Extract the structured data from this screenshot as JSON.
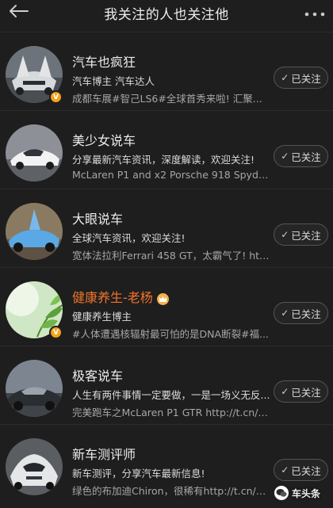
{
  "header": {
    "title": "我关注的人也关注他",
    "back_icon": "arrow-left-icon",
    "more_icon": "more-dots-icon"
  },
  "users": [
    {
      "name": "汽车也疯狂",
      "line1": "汽车博主 汽车达人",
      "line2": "成都车展#智己LS6#全球首秀来啦! 汇聚...",
      "follow_label": "已关注",
      "verified": true
    },
    {
      "name": "美少女说车",
      "line1": "分享最新汽车资讯，深度解读，欢迎关注!",
      "line2": "McLaren P1 and x2 Porsche 918 Spyders...",
      "follow_label": "已关注",
      "verified": false
    },
    {
      "name": "大眼说车",
      "line1": "全球汽车资讯，欢迎关注!",
      "line2": "宽体法拉利Ferrari 458 GT，太霸气了! htt...",
      "follow_label": "已关注",
      "verified": false
    },
    {
      "name": "健康养生-老杨",
      "line1": "健康养生博主",
      "line2": "#人体遭遇核辐射最可怕的是DNA断裂#福...",
      "follow_label": "已关注",
      "verified": true
    },
    {
      "name": "极客说车",
      "line1": "人生有两件事情一定要做，一是一场义无反...",
      "line2": "完美跑车之McLaren P1 GTR http://t.cn/A...",
      "follow_label": "已关注",
      "verified": false
    },
    {
      "name": "新车测评师",
      "line1": "新车测评，分享汽车最新信息!",
      "line2": "绿色的布加迪Chiron，很稀有http://t.cn/A...",
      "follow_label": "已关注",
      "verified": false
    }
  ],
  "watermark": {
    "text": "车头条"
  },
  "colors": {
    "background": "#1e1e1e",
    "highlight_name": "#f0742a",
    "verified_badge": "#f3a21b"
  }
}
